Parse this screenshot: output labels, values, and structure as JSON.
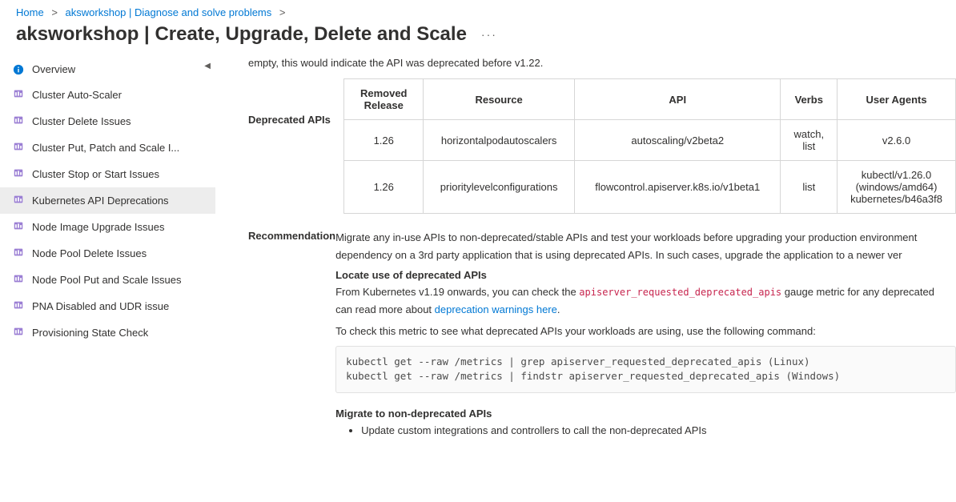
{
  "breadcrumb": {
    "home": "Home",
    "mid": "aksworkshop | Diagnose and solve problems"
  },
  "page_title": "aksworkshop | Create, Upgrade, Delete and Scale",
  "sidebar": {
    "overview": "Overview",
    "items": [
      "Cluster Auto-Scaler",
      "Cluster Delete Issues",
      "Cluster Put, Patch and Scale I...",
      "Cluster Stop or Start Issues",
      "Kubernetes API Deprecations",
      "Node Image Upgrade Issues",
      "Node Pool Delete Issues",
      "Node Pool Put and Scale Issues",
      "PNA Disabled and UDR issue",
      "Provisioning State Check"
    ],
    "selected_index": 4
  },
  "content": {
    "top_para": "empty, this would indicate the API was deprecated before v1.22.",
    "deprecated_label": "Deprecated APIs",
    "table": {
      "headers": [
        "Removed Release",
        "Resource",
        "API",
        "Verbs",
        "User Agents"
      ],
      "rows": [
        [
          "1.26",
          "horizontalpodautoscalers",
          "autoscaling/v2beta2",
          "watch, list",
          "v2.6.0"
        ],
        [
          "1.26",
          "prioritylevelconfigurations",
          "flowcontrol.apiserver.k8s.io/v1beta1",
          "list",
          "kubectl/v1.26.0 (windows/amd64) kubernetes/b46a3f8"
        ]
      ]
    },
    "reco_label": "Recommendation",
    "reco_text_a": "Migrate any in-use APIs to non-deprecated/stable APIs and test your workloads before upgrading your production environment",
    "reco_text_b": "dependency on a 3rd party application that is using deprecated APIs. In such cases, upgrade the application to a newer ver",
    "locate_h": "Locate use of deprecated APIs",
    "locate_p1a": "From Kubernetes v1.19 onwards, you can check the ",
    "locate_code": "apiserver_requested_deprecated_apis",
    "locate_p1b": " gauge metric for any deprecated",
    "locate_p1c": "can read more about ",
    "locate_link": "deprecation warnings here",
    "locate_p2": "To check this metric to see what deprecated APIs your workloads are using, use the following command:",
    "codeblock": "kubectl get --raw /metrics | grep apiserver_requested_deprecated_apis (Linux)\nkubectl get --raw /metrics | findstr apiserver_requested_deprecated_apis (Windows)",
    "migrate_h": "Migrate to non-deprecated APIs",
    "migrate_b1": "Update custom integrations and controllers to call the non-deprecated APIs"
  }
}
